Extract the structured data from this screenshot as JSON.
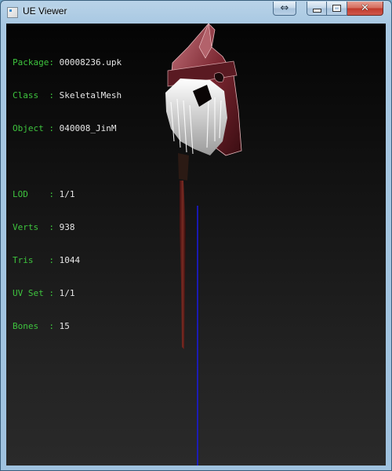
{
  "window": {
    "title": "UE Viewer",
    "restore_size_label": "⇔",
    "close_glyph": "✕"
  },
  "info": {
    "package": {
      "label": "Package:",
      "value": "00008236.upk"
    },
    "class": {
      "label": "Class  :",
      "value": "SkeletalMesh"
    },
    "object": {
      "label": "Object :",
      "value": "040008_JinM"
    },
    "lod": {
      "label": "LOD    :",
      "value": "1/1"
    },
    "verts": {
      "label": "Verts  :",
      "value": "938"
    },
    "tris": {
      "label": "Tris   :",
      "value": "1044"
    },
    "uvset": {
      "label": "UV Set :",
      "value": "1/1"
    },
    "bones": {
      "label": "Bones  :",
      "value": "15"
    }
  },
  "colors": {
    "label_green": "#3ec43e",
    "value_text": "#e6e6e6",
    "axis_blue": "#1a1ad8",
    "mesh_red": "#8a2a30"
  },
  "icons": [
    "app-icon",
    "restore-size-icon",
    "minimize-icon",
    "maximize-icon",
    "close-icon"
  ]
}
